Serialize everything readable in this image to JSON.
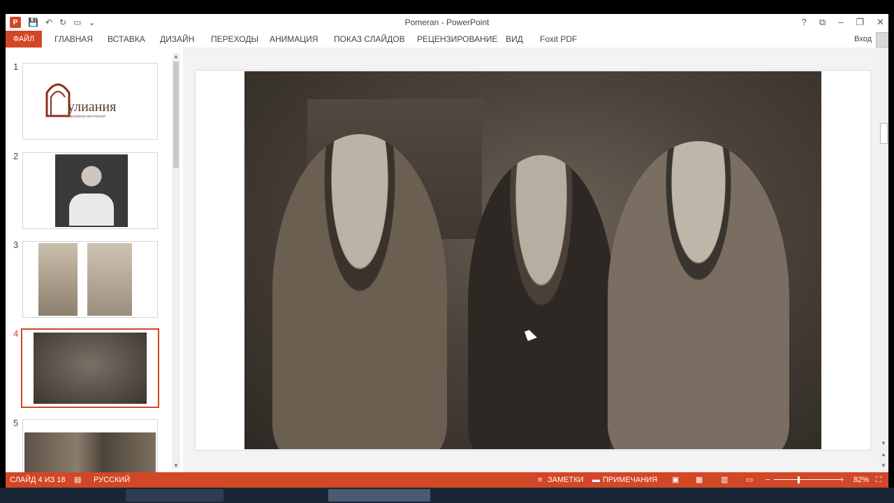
{
  "window": {
    "title": "Pomeran - PowerPoint",
    "app_icon": "P",
    "controls": [
      "?",
      "⧉",
      "–",
      "❐",
      "✕"
    ]
  },
  "quick_access": {
    "save_icon": "💾",
    "undo_icon": "↶",
    "redo_icon": "↻",
    "presentation_icon": "▭",
    "customize_icon": "⌄"
  },
  "ribbon": {
    "file_tab": "ФАЙЛ",
    "tabs": [
      "ГЛАВНАЯ",
      "ВСТАВКА",
      "ДИЗАЙН",
      "ПЕРЕХОДЫ",
      "АНИМАЦИЯ",
      "ПОКАЗ СЛАЙДОВ",
      "РЕЦЕНЗИРОВАНИЕ",
      "ВИД",
      "Foxit PDF"
    ],
    "sign_in": "Вход"
  },
  "thumbnails": [
    {
      "number": "1",
      "logo_text": "улиания",
      "logo_subtitle": "ювелирная мастерская"
    },
    {
      "number": "2"
    },
    {
      "number": "3"
    },
    {
      "number": "4"
    },
    {
      "number": "5"
    }
  ],
  "status_bar": {
    "slide_info": "СЛАЙД 4 ИЗ 18",
    "language": "РУССКИЙ",
    "notes": "ЗАМЕТКИ",
    "comments": "ПРИМЕЧАНИЯ",
    "zoom": "82%"
  },
  "colors": {
    "accent": "#d24726"
  }
}
